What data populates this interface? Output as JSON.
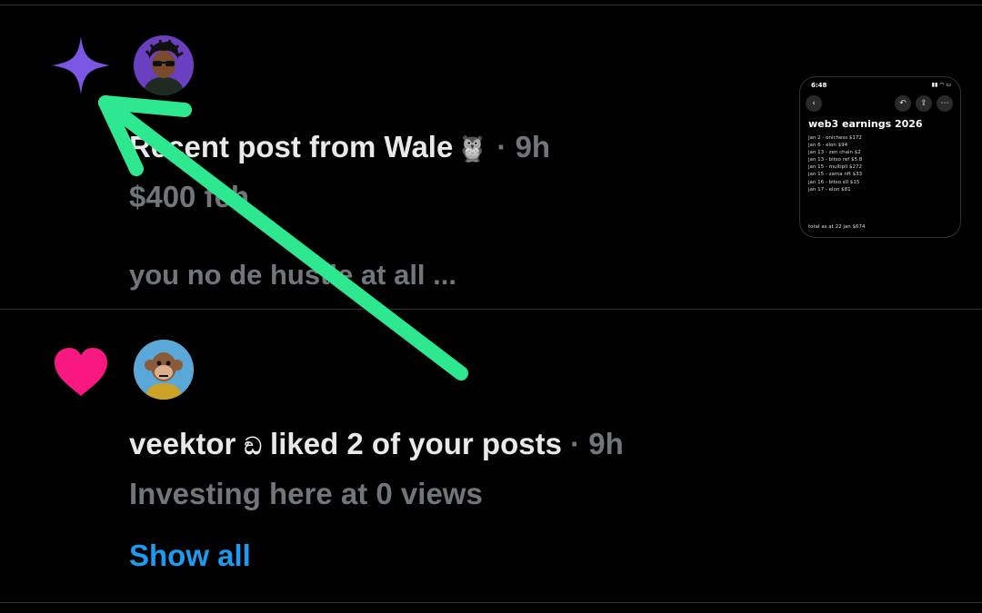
{
  "notifications": [
    {
      "type": "new-post",
      "author": "Wale",
      "emoji": "🦉",
      "title_text": "Recent post from Wale",
      "separator": "·",
      "time": "9h",
      "line2": "$400 feh",
      "line3": "you no de hustle at all ...",
      "thumbnail": {
        "status_time": "6:48",
        "title": "web3 earnings 2026",
        "lines": [
          "jan 2 - onichess $172",
          "jan 6 - elon $94",
          "jan 13 - zen chain $2",
          "jan 13 - bitso ref $5.8",
          "jan 15 - multipli $272",
          "jan 15 - zama nft $33",
          "jan 16 - bitso s0 $15",
          "jan 17 - elon $81"
        ],
        "total": "total as at 22 jan $674"
      }
    },
    {
      "type": "like",
      "user": "veektor",
      "user_symbol": "ඞ",
      "action": "liked 2 of your posts",
      "separator": "·",
      "time": "9h",
      "line2": "Investing here at 0 views",
      "show_all": "Show all"
    }
  ],
  "colors": {
    "background": "#000000",
    "star_icon": "#7b57e4",
    "heart_icon": "#f91880",
    "link": "#1d9bf0",
    "muted_text": "#71767b",
    "annotation_arrow": "#2ee88f"
  },
  "icons": [
    "sparkle-star-icon",
    "heart-icon",
    "avatar",
    "annotation-arrow"
  ]
}
